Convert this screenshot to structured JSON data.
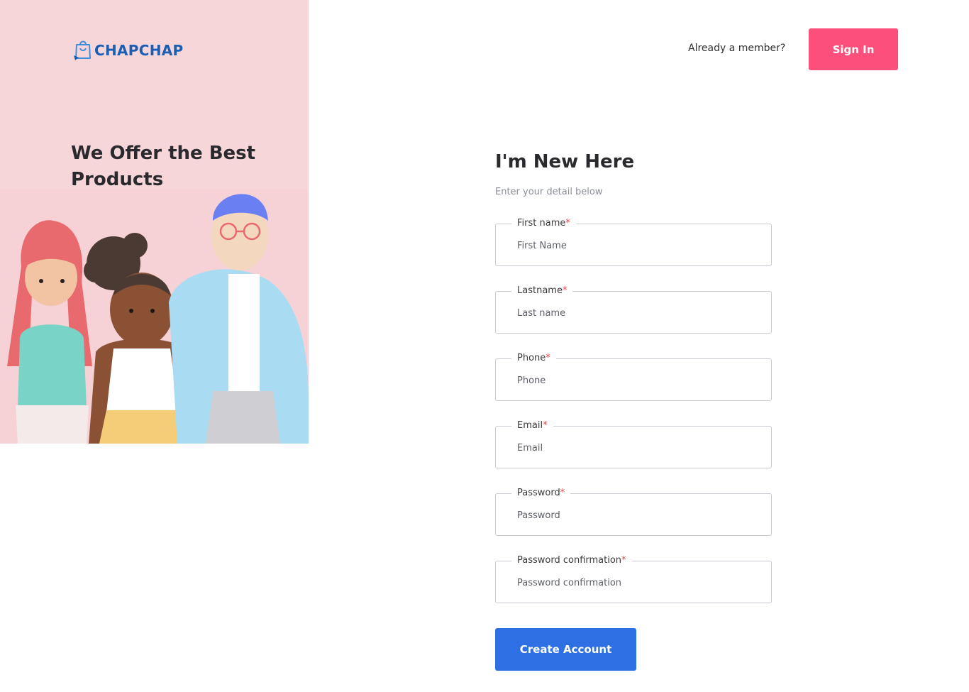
{
  "brand": {
    "name": "CHAPCHAP",
    "color": "#1a5fb4"
  },
  "hero": {
    "title": "We Offer the Best Products"
  },
  "header": {
    "member_text": "Already a member?",
    "signin_label": "Sign In"
  },
  "form": {
    "title": "I'm New Here",
    "subtitle": "Enter your detail below",
    "fields": [
      {
        "label": "First name",
        "required_mark": "*",
        "placeholder": "First Name"
      },
      {
        "label": "Lastname",
        "required_mark": "*",
        "placeholder": "Last name"
      },
      {
        "label": "Phone",
        "required_mark": "*",
        "placeholder": "Phone"
      },
      {
        "label": "Email",
        "required_mark": "*",
        "placeholder": "Email"
      },
      {
        "label": "Password",
        "required_mark": "*",
        "placeholder": "Password"
      },
      {
        "label": "Password confirmation",
        "required_mark": "*",
        "placeholder": "Password confirmation"
      }
    ],
    "submit_label": "Create Account"
  },
  "colors": {
    "panel_bg": "#f7d6da",
    "signin_bg": "#fd4f7c",
    "submit_bg": "#2f6fe4",
    "required": "#e5484d"
  }
}
